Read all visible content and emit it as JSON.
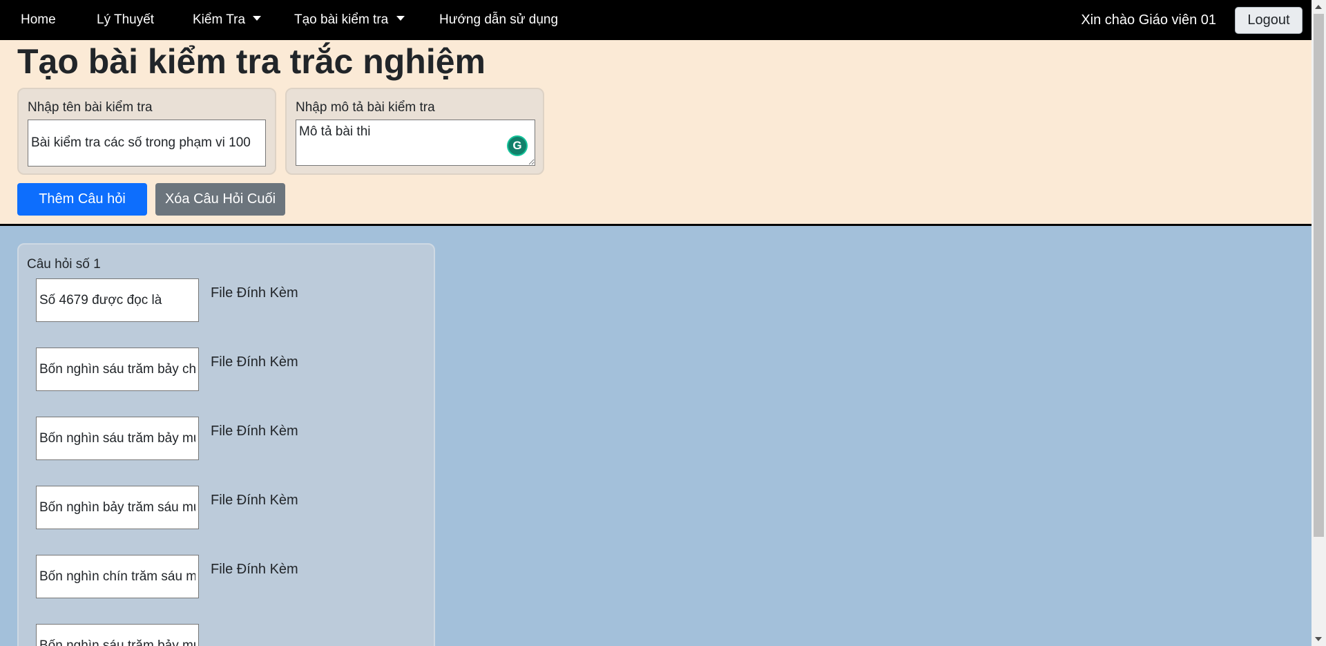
{
  "navbar": {
    "items": [
      {
        "label": "Home"
      },
      {
        "label": "Lý Thuyết"
      },
      {
        "label": "Kiểm Tra",
        "dropdown": true
      },
      {
        "label": "Tạo bài kiểm tra",
        "dropdown": true
      },
      {
        "label": "Hướng dẫn sử dụng"
      }
    ],
    "greeting": "Xin chào Giáo viên 01",
    "logout_label": "Logout"
  },
  "header": {
    "title": "Tạo bài kiểm tra trắc nghiệm",
    "name_field": {
      "label": "Nhập tên bài kiểm tra",
      "value": "Bài kiểm tra các số trong phạm vi 100"
    },
    "description_field": {
      "label": "Nhập mô tả bài kiểm tra",
      "value": "Mô tả bài thi"
    },
    "grammarly_icon": "G",
    "add_question_label": "Thêm Câu hỏi",
    "delete_last_label": "Xóa Câu Hỏi Cuối"
  },
  "question": {
    "label": "Câu hỏi số 1",
    "rows": [
      {
        "value": "Số 4679 được đọc là",
        "file_label": "File Đính Kèm"
      },
      {
        "value": "Bốn nghìn sáu trăm bảy chục chín",
        "file_label": "File Đính Kèm"
      },
      {
        "value": "Bốn nghìn sáu trăm bảy mươi chín",
        "file_label": "File Đính Kèm"
      },
      {
        "value": "Bốn nghìn bảy trăm sáu mươi chín",
        "file_label": "File Đính Kèm"
      },
      {
        "value": "Bốn nghìn chín trăm sáu mươi bảy",
        "file_label": "File Đính Kèm"
      },
      {
        "value": "Bốn nghìn sáu trăm bảy mươi chín",
        "file_label": ""
      }
    ]
  },
  "colors": {
    "navbar_bg": "#000000",
    "header_bg": "#fbead6",
    "body_bg": "#a3c0da",
    "primary": "#0d6efd",
    "secondary": "#6c757d"
  }
}
